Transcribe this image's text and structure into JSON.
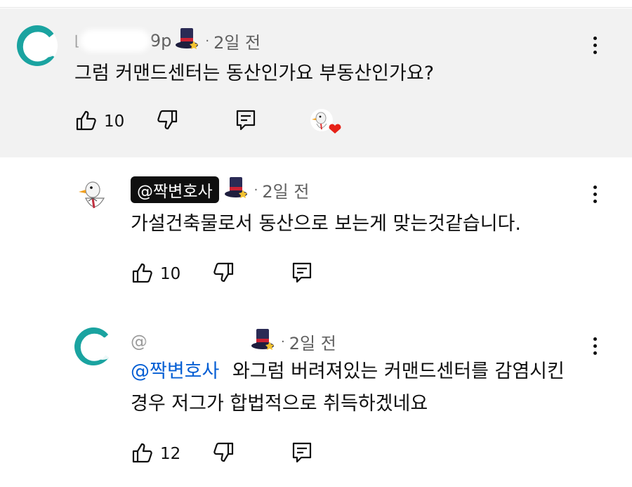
{
  "comments": [
    {
      "author_visible_suffix": "9p",
      "time": "2일 전",
      "text": "그럼 커맨드센터는 동산인가요 부동산인가요?",
      "likes": "10"
    },
    {
      "author": "@짝변호사",
      "time": "2일 전",
      "text": "가설건축물로서 동산으로 보는게 맞는것같습니다.",
      "likes": "10"
    },
    {
      "author_visible_prefix": "@",
      "time": "2일 전",
      "mention": "@짝변호사",
      "text_line1": "와그럼 버려져있는 커맨드센터를 감염시킨",
      "text_line2": "경우 저그가 합법적으로 취득하겠네요",
      "likes": "12"
    }
  ],
  "separator": "·",
  "colors": {
    "highlight_bg": "#f2f2f2",
    "mention": "#065fd4",
    "badge_bg": "#0f0f0f"
  }
}
